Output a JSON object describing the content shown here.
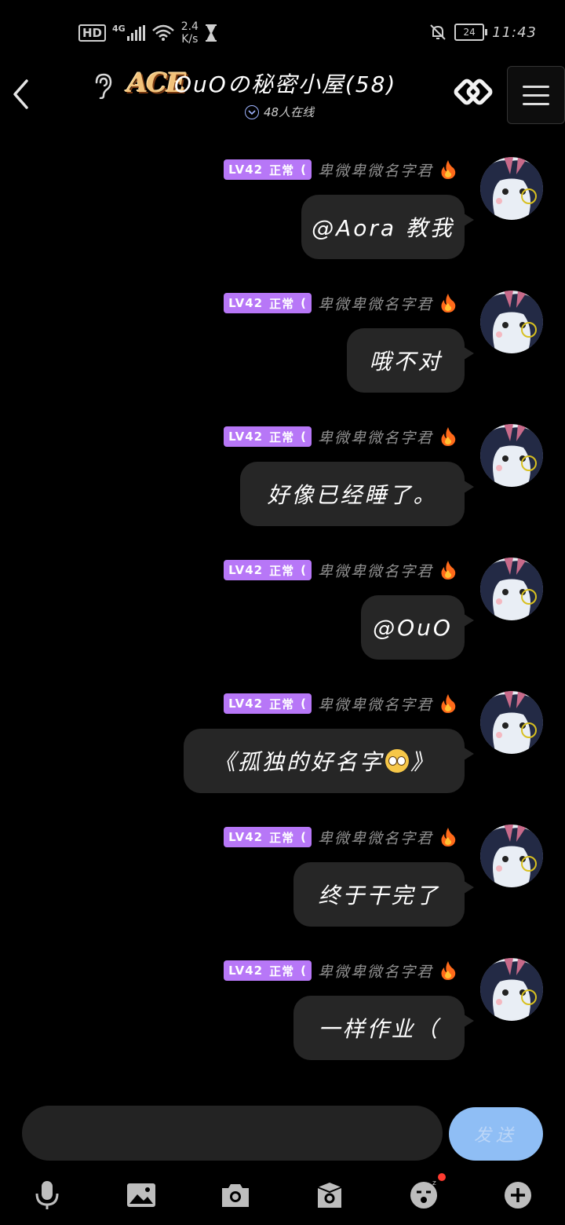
{
  "status_bar": {
    "hd": "HD",
    "network": "4G",
    "speed_value": "2.4",
    "speed_unit": "K/s",
    "battery": "24",
    "time": "11:43"
  },
  "header": {
    "logo_text": "ACE",
    "title": "OuOの秘密小屋(58)",
    "online": "48人在线"
  },
  "messages": [
    {
      "level": "LV42",
      "title_tag": "正常",
      "tag_suffix": "(",
      "sender": "卑微卑微名字君",
      "text": "@Aora 教我",
      "width": 208
    },
    {
      "level": "LV42",
      "title_tag": "正常",
      "tag_suffix": "(",
      "sender": "卑微卑微名字君",
      "text": "哦不对",
      "width": 150
    },
    {
      "level": "LV42",
      "title_tag": "正常",
      "tag_suffix": "(",
      "sender": "卑微卑微名字君",
      "text": "好像已经睡了。",
      "width": 286
    },
    {
      "level": "LV42",
      "title_tag": "正常",
      "tag_suffix": "(",
      "sender": "卑微卑微名字君",
      "text": "@OuO",
      "width": 132
    },
    {
      "level": "LV42",
      "title_tag": "正常",
      "tag_suffix": "(",
      "sender": "卑微卑微名字君",
      "text_before": "《孤独的好名字",
      "emoji": "pleading-face",
      "text_after": "》",
      "width": 358
    },
    {
      "level": "LV42",
      "title_tag": "正常",
      "tag_suffix": "(",
      "sender": "卑微卑微名字君",
      "text": "终于干完了",
      "width": 218
    },
    {
      "level": "LV42",
      "title_tag": "正常",
      "tag_suffix": "(",
      "sender": "卑微卑微名字君",
      "text": "一样作业（",
      "width": 218
    }
  ],
  "input": {
    "placeholder": "",
    "send_label": "发送"
  },
  "toolbar": {
    "icons": [
      "microphone-icon",
      "image-icon",
      "camera-icon",
      "package-icon",
      "emoji-icon",
      "plus-icon"
    ]
  },
  "colors": {
    "background": "#000000",
    "bubble": "#262626",
    "level_badge": "#b777f7",
    "send_button": "#8fbef5",
    "fire": "#ff6a1a"
  }
}
